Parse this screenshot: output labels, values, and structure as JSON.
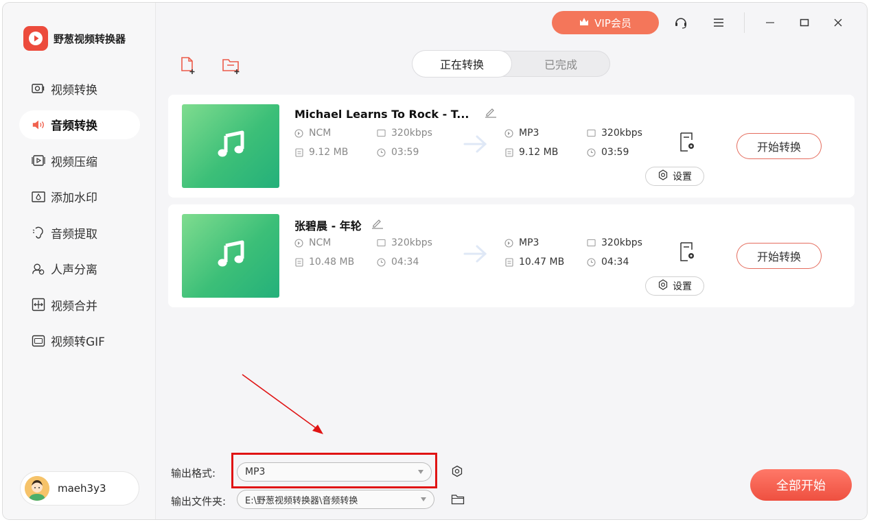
{
  "app": {
    "name": "野葱视频转换器"
  },
  "sidebar": {
    "items": [
      {
        "label": "视频转换",
        "icon": "video-convert-icon",
        "active": false
      },
      {
        "label": "音频转换",
        "icon": "audio-convert-icon",
        "active": true
      },
      {
        "label": "视频压缩",
        "icon": "video-compress-icon",
        "active": false
      },
      {
        "label": "添加水印",
        "icon": "watermark-icon",
        "active": false
      },
      {
        "label": "音频提取",
        "icon": "audio-extract-icon",
        "active": false
      },
      {
        "label": "人声分离",
        "icon": "vocal-separate-icon",
        "active": false
      },
      {
        "label": "视频合并",
        "icon": "video-merge-icon",
        "active": false
      },
      {
        "label": "视频转GIF",
        "icon": "gif-icon",
        "active": false
      }
    ]
  },
  "user": {
    "name": "maeh3y3"
  },
  "topbar": {
    "vip_label": "VIP会员"
  },
  "tabs": {
    "converting": "正在转换",
    "done": "已完成",
    "active": "converting"
  },
  "files": [
    {
      "title": "Michael Learns To Rock - T...",
      "src": {
        "format": "NCM",
        "bitrate": "320kbps",
        "size": "9.12 MB",
        "duration": "03:59"
      },
      "dst": {
        "format": "MP3",
        "bitrate": "320kbps",
        "size": "9.12 MB",
        "duration": "03:59"
      },
      "settings_label": "设置",
      "start_label": "开始转换"
    },
    {
      "title": "张碧晨 - 年轮",
      "src": {
        "format": "NCM",
        "bitrate": "320kbps",
        "size": "10.48 MB",
        "duration": "04:34"
      },
      "dst": {
        "format": "MP3",
        "bitrate": "320kbps",
        "size": "10.47 MB",
        "duration": "04:34"
      },
      "settings_label": "设置",
      "start_label": "开始转换"
    }
  ],
  "output": {
    "format_label": "输出格式:",
    "format_value": "MP3",
    "folder_label": "输出文件夹:",
    "folder_value": "E:\\野葱视频转换器\\音频转换"
  },
  "start_all_label": "全部开始",
  "colors": {
    "accent": "#f4765a",
    "highlight_box": "#e01414",
    "thumb": "#3cbf78"
  }
}
